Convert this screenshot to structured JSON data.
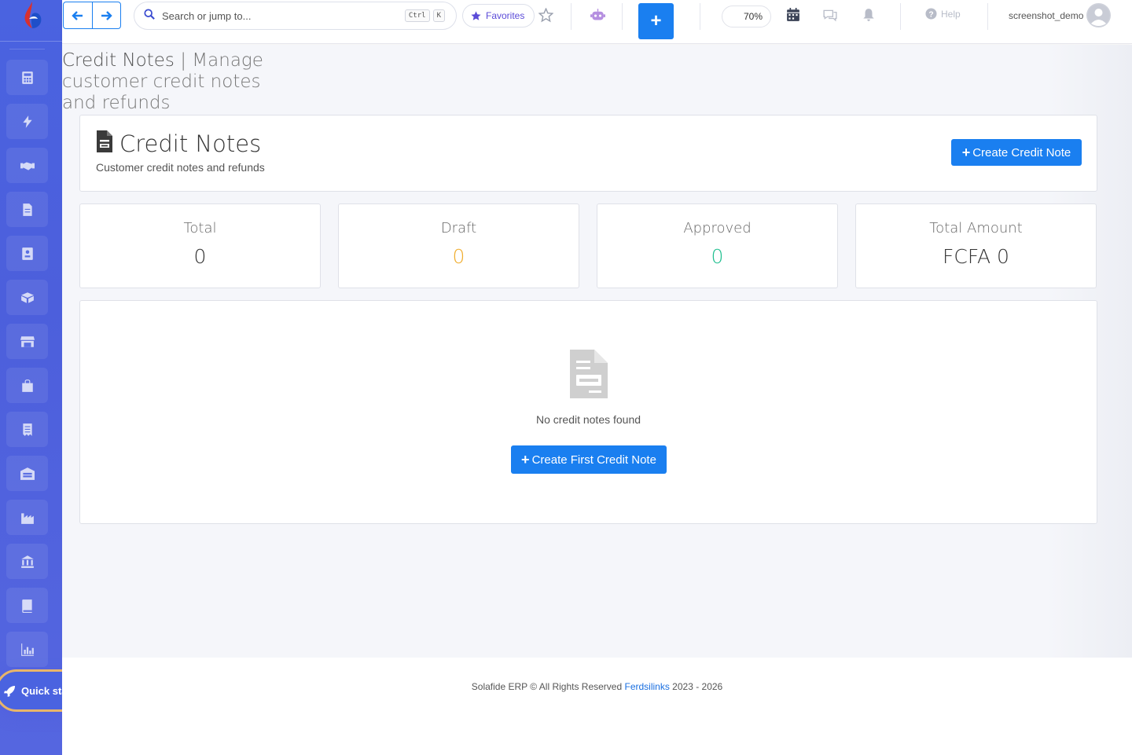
{
  "app": {
    "accent_color": "#1a7ff0",
    "sidebar_color": "#4a63e0"
  },
  "sidebar": {
    "items": [
      {
        "icon": "calculator-icon"
      },
      {
        "icon": "bolt-icon"
      },
      {
        "icon": "handshake-icon"
      },
      {
        "icon": "document-icon"
      },
      {
        "icon": "contact-card-icon"
      },
      {
        "icon": "boxes-icon"
      },
      {
        "icon": "store-icon"
      },
      {
        "icon": "briefcase-icon"
      },
      {
        "icon": "receipt-icon"
      },
      {
        "icon": "warehouse-icon"
      },
      {
        "icon": "factory-icon"
      },
      {
        "icon": "bank-icon"
      },
      {
        "icon": "book-icon"
      },
      {
        "icon": "bar-chart-icon"
      }
    ],
    "quick_start_label": "Quick start"
  },
  "topbar": {
    "search_placeholder": "Search or jump to...",
    "shortcut_keys": [
      "Ctrl",
      "K"
    ],
    "favorites_label": "Favorites",
    "zoom_label": "70%",
    "help_label": "Help",
    "username": "screenshot_demo"
  },
  "page": {
    "title": "Credit Notes",
    "title_separator": " | ",
    "title_description": "Manage customer credit notes and refunds"
  },
  "header_card": {
    "title": "Credit Notes",
    "subtitle": "Customer credit notes and refunds",
    "create_button_label": "Create Credit Note"
  },
  "stats": [
    {
      "label": "Total",
      "value": "0",
      "color": "#333333"
    },
    {
      "label": "Draft",
      "value": "0",
      "color": "#f0ad2e"
    },
    {
      "label": "Approved",
      "value": "0",
      "color": "#1fbf8f"
    },
    {
      "label": "Total Amount",
      "value": "FCFA 0",
      "color": "#333333"
    }
  ],
  "empty_state": {
    "message": "No credit notes found",
    "button_label": "Create First Credit Note"
  },
  "footer": {
    "prefix": "Solafide ERP © All Rights Reserved ",
    "link_text": "Ferdsilinks",
    "suffix": " 2023 - 2026"
  }
}
